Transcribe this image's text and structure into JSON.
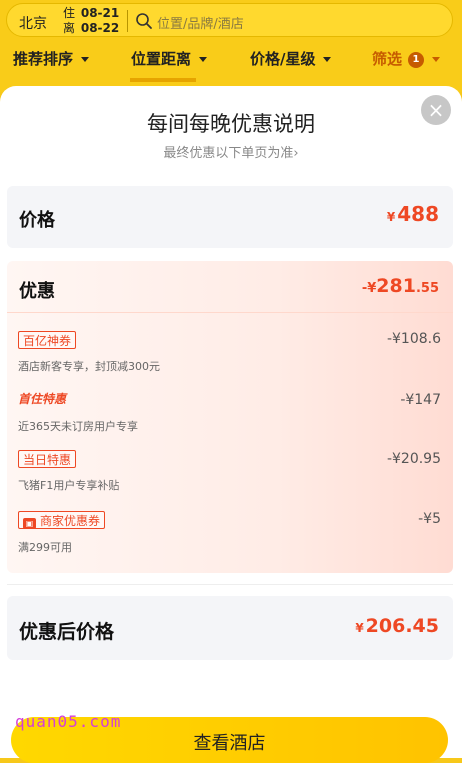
{
  "header": {
    "city": "北京",
    "checkin_label": "住",
    "checkin_date": "08-21",
    "checkout_label": "离",
    "checkout_date": "08-22",
    "search_placeholder": "位置/品牌/酒店"
  },
  "filters": [
    {
      "label": "推荐排序"
    },
    {
      "label": "位置距离"
    },
    {
      "label": "价格/星级"
    },
    {
      "label": "筛选",
      "badge": "1"
    }
  ],
  "modal": {
    "title": "每间每晚优惠说明",
    "subtitle": "最终优惠以下单页为准",
    "subtitle_arrow": "›",
    "close_icon": "×",
    "price": {
      "label": "价格",
      "currency": "¥",
      "value": "488"
    },
    "discount": {
      "label": "优惠",
      "prefix": "-¥",
      "value_int": "281",
      "value_dec": ".55",
      "items": [
        {
          "tag": "百亿神券",
          "desc": "酒店新客专享，封顶减300元",
          "amount": "-¥108.6"
        },
        {
          "tag": "首住特惠",
          "desc": "近365天未订房用户专享",
          "amount": "-¥147"
        },
        {
          "tag": "当日特惠",
          "desc": "飞猪F1用户专享补贴",
          "amount": "-¥20.95"
        },
        {
          "tag": "商家优惠券",
          "desc": "满299可用",
          "amount": "-¥5",
          "tag_icon": "coupon-icon"
        }
      ]
    },
    "final": {
      "label": "优惠后价格",
      "currency": "¥",
      "value": "206.45"
    },
    "button_label": "查看酒店"
  },
  "watermark": "quan05.com",
  "colors": {
    "accent": "#ee4824",
    "brand_yellow": "#ffd200",
    "filter_active": "#c65b00"
  }
}
